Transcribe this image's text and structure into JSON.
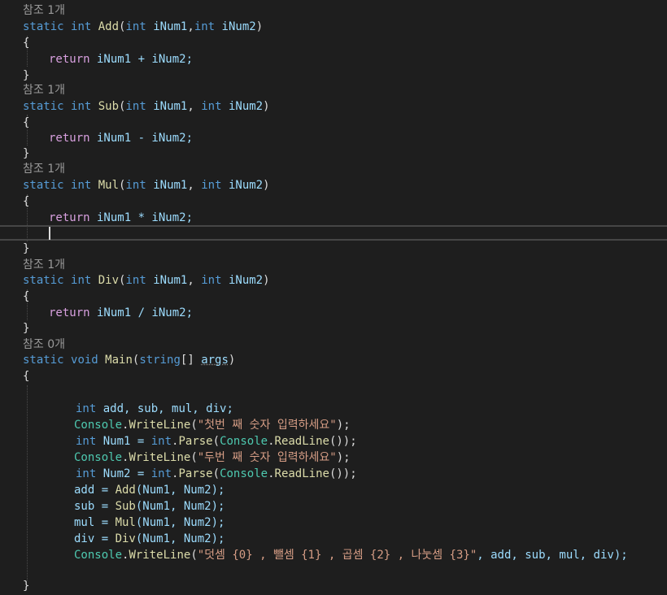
{
  "editor": {
    "ref_add": "참조 1개",
    "ref_sub": "참조 1개",
    "ref_mul": "참조 1개",
    "ref_div": "참조 1개",
    "ref_main": "참조 0개",
    "kw_static": "static",
    "kw_int": "int",
    "kw_void": "void",
    "kw_return": "return",
    "kw_string": "string",
    "fn_add": "Add",
    "fn_sub": "Sub",
    "fn_mul": "Mul",
    "fn_div": "Div",
    "fn_main": "Main",
    "p_inum1": "iNum1",
    "p_inum2": "iNum2",
    "open_brace": "{",
    "close_brace": "}",
    "lines": {
      "add_params_sep": ",",
      "sub_params_sep": ", ",
      "ret_add": " iNum1 + iNum2;",
      "ret_sub": " iNum1 - iNum2;",
      "ret_mul": " iNum1 * iNum2;",
      "ret_div": " iNum1 / iNum2;",
      "main_params": "[] ",
      "main_args": "args",
      "decl_vars": " add, sub, mul, div;",
      "console": "Console",
      "writeline": "WriteLine",
      "readline": "ReadLine",
      "parse": "Parse",
      "str_first": "\"첫번 째 숫자 입력하세요\"",
      "str_second": "\"두번 째 숫자 입력하세요\"",
      "num1_decl": " Num1 = ",
      "num2_decl": " Num2 = ",
      "assign_add": "add = ",
      "assign_sub": "sub = ",
      "assign_mul": "mul = ",
      "assign_div": "div = ",
      "call_args": "(Num1, Num2);",
      "str_result": "\"덧셈 {0} , 뺄셈 {1} , 곱셈 {2} , 나눗셈 {3}\"",
      "result_args": ", add, sub, mul, div);"
    }
  }
}
